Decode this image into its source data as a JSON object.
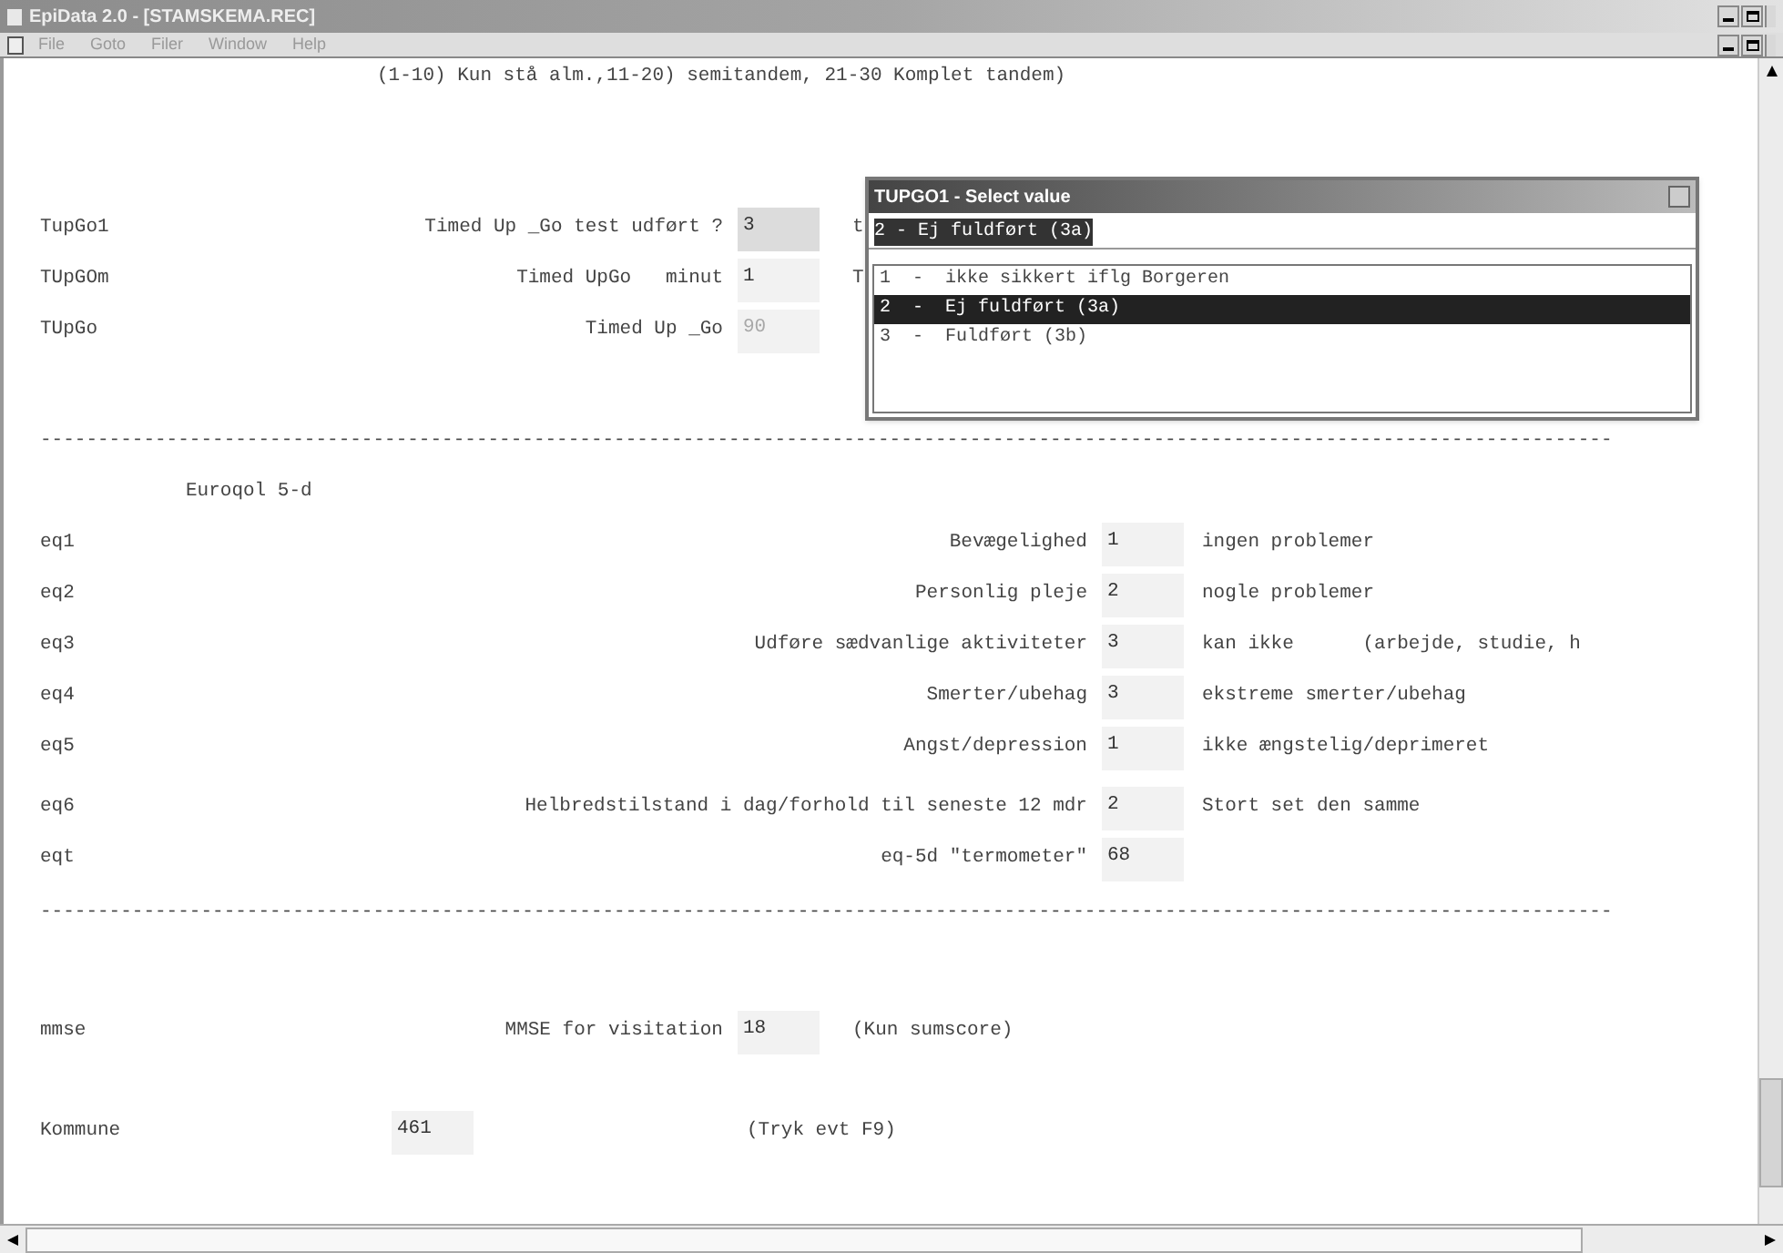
{
  "window": {
    "title": "EpiData 2.0 - [STAMSKEMA.REC]"
  },
  "menu": [
    "File",
    "Goto",
    "Filer",
    "Window",
    "Help"
  ],
  "sections": [
    {
      "rows": [
        {
          "kind": "header",
          "text": "(1-10) Kun stå alm.,11-20) semitandem, 21-30 Komplet tandem)"
        }
      ]
    },
    {
      "rows": [
        {
          "kind": "timed",
          "name": "TupGo1",
          "prompt": "Timed Up _Go test udført ?",
          "value": "3",
          "focused": true,
          "disabled": false,
          "note": "t"
        },
        {
          "kind": "timed",
          "name": "TUpGOm",
          "prompt": "Timed UpGo   minut",
          "value": "1",
          "focused": false,
          "disabled": false,
          "note": "T"
        },
        {
          "kind": "timed",
          "name": "TUpGo",
          "prompt": "Timed Up _Go",
          "value": "90",
          "focused": false,
          "disabled": true
        }
      ]
    },
    {
      "rows": [
        {
          "kind": "separator",
          "text": "-----------------------------------------------------------------------------------------------------------------------------------------"
        }
      ]
    },
    {
      "rows": [
        {
          "kind": "title",
          "text": "Euroqol 5-d"
        },
        {
          "kind": "eq",
          "name": "eq1",
          "prompt": "Bevægelighed",
          "value": "1",
          "focused": false,
          "disabled": false,
          "note": "ingen problemer"
        },
        {
          "kind": "eq",
          "name": "eq2",
          "prompt": "Personlig pleje",
          "value": "2",
          "focused": false,
          "disabled": false,
          "note": "nogle problemer"
        },
        {
          "kind": "eq",
          "name": "eq3",
          "prompt": "Udføre sædvanlige aktiviteter",
          "value": "3",
          "focused": false,
          "disabled": false,
          "note": "kan ikke      (arbejde, studie, h"
        },
        {
          "kind": "eq",
          "name": "eq4",
          "prompt": "Smerter/ubehag",
          "value": "3",
          "focused": false,
          "disabled": false,
          "note": "ekstreme smerter/ubehag"
        },
        {
          "kind": "eq",
          "name": "eq5",
          "prompt": "Angst/depression",
          "value": "1",
          "focused": false,
          "disabled": false,
          "note": "ikke ængstelig/deprimeret"
        }
      ]
    },
    {
      "rows": [
        {
          "kind": "eq",
          "name": "eq6",
          "prompt": "Helbredstilstand i dag/forhold til seneste 12 mdr",
          "value": "2",
          "focused": false,
          "disabled": false,
          "note": "Stort set den samme"
        },
        {
          "kind": "eq",
          "name": "eqt",
          "prompt": "eq-5d \"termometer\"",
          "value": "68",
          "focused": false,
          "disabled": false
        }
      ]
    },
    {
      "rows": [
        {
          "kind": "separator",
          "text": "-----------------------------------------------------------------------------------------------------------------------------------------"
        }
      ]
    },
    {
      "rows": [
        {
          "kind": "timed",
          "name": "mmse",
          "prompt": "MMSE for visitation",
          "value": "18",
          "focused": false,
          "disabled": false,
          "note": "(Kun sumscore)"
        }
      ]
    },
    {
      "rows": [
        {
          "kind": "plain",
          "name": "Kommune",
          "value": "461",
          "focused": false,
          "disabled": false,
          "note": "(Tryk evt F9)"
        }
      ]
    }
  ],
  "dialog": {
    "title": "TUPGO1 - Select value",
    "value": "2 - Ej fuldført (3a)",
    "options": [
      {
        "label": "1  -  ikke sikkert iflg Borgeren",
        "selected": false
      },
      {
        "label": "2  -  Ej fuldført (3a)",
        "selected": true
      },
      {
        "label": "3  -  Fuldført (3b)",
        "selected": false
      }
    ]
  }
}
